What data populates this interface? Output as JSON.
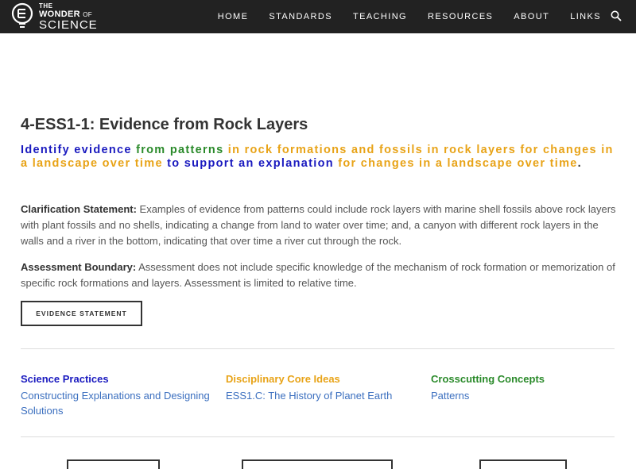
{
  "brand": {
    "the": "THE",
    "wonder": "WONDER",
    "of": "OF",
    "science": "SCIENCE"
  },
  "nav": {
    "items": [
      {
        "label": "HOME"
      },
      {
        "label": "STANDARDS"
      },
      {
        "label": "TEACHING"
      },
      {
        "label": "RESOURCES"
      },
      {
        "label": "ABOUT"
      },
      {
        "label": "LINKS"
      }
    ],
    "search_icon": "search-icon"
  },
  "page": {
    "title": "4-ESS1-1: Evidence from Rock Layers",
    "performance_expectation": [
      {
        "text": "Identify evidence",
        "color": "#1a1abf"
      },
      {
        "text": " from patterns",
        "color": "#2a8a2a"
      },
      {
        "text": " in rock formations and fossils in rock layers for changes in a landscape over time",
        "color": "#e8a317"
      },
      {
        "text": " to support an explanation",
        "color": "#1a1abf"
      },
      {
        "text": " for changes in a landscape over time",
        "color": "#e8a317"
      },
      {
        "text": ".",
        "color": "#333333"
      }
    ],
    "clarification_label": "Clarification Statement:",
    "clarification_text": " Examples of evidence from patterns could include rock layers with marine shell fossils above rock layers with plant fossils and no shells, indicating a change from land to water over time; and, a canyon with different rock layers in the walls and a river in the bottom, indicating that over time a river cut through the rock.",
    "assessment_label": "Assessment Boundary:",
    "assessment_text": " Assessment does not include specific knowledge of the mechanism of rock formation or memorization of specific rock formations and layers. Assessment is limited to relative time.",
    "evidence_button": "EVIDENCE STATEMENT"
  },
  "dimensions": [
    {
      "heading": "Science Practices",
      "color": "#1a1abf",
      "link": "Constructing Explanations and Designing Solutions"
    },
    {
      "heading": "Disciplinary Core Ideas",
      "color": "#e8a317",
      "link": "ESS1.C: The History of Planet Earth"
    },
    {
      "heading": "Crosscutting Concepts",
      "color": "#2a8a2a",
      "link": "Patterns"
    }
  ]
}
